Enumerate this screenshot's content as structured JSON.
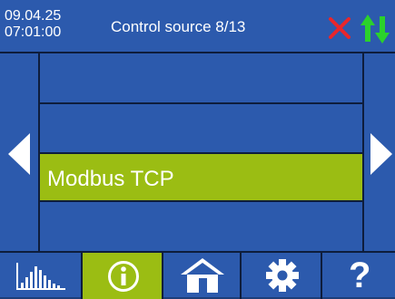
{
  "header": {
    "date": "09.04.25",
    "time": "07:01:00",
    "title": "Control source 8/13",
    "icons": [
      "error-x-icon",
      "transfer-arrows-icon"
    ]
  },
  "list": {
    "items": [
      {
        "label": ""
      },
      {
        "label": ""
      },
      {
        "label": "Modbus TCP",
        "selected": true
      },
      {
        "label": ""
      }
    ]
  },
  "nav": {
    "prev_icon": "triangle-left-icon",
    "next_icon": "triangle-right-icon"
  },
  "tabs": [
    {
      "icon": "bar-chart-icon",
      "active": false
    },
    {
      "icon": "info-icon",
      "active": true
    },
    {
      "icon": "home-icon",
      "active": false
    },
    {
      "icon": "gear-icon",
      "active": false
    },
    {
      "icon": "help-icon",
      "label": "?",
      "active": false
    }
  ],
  "colors": {
    "background": "#2c5aad",
    "selected": "#9bbd13",
    "divider": "#0e1d3c",
    "error": "#e8262b",
    "ok": "#2bd12b"
  }
}
